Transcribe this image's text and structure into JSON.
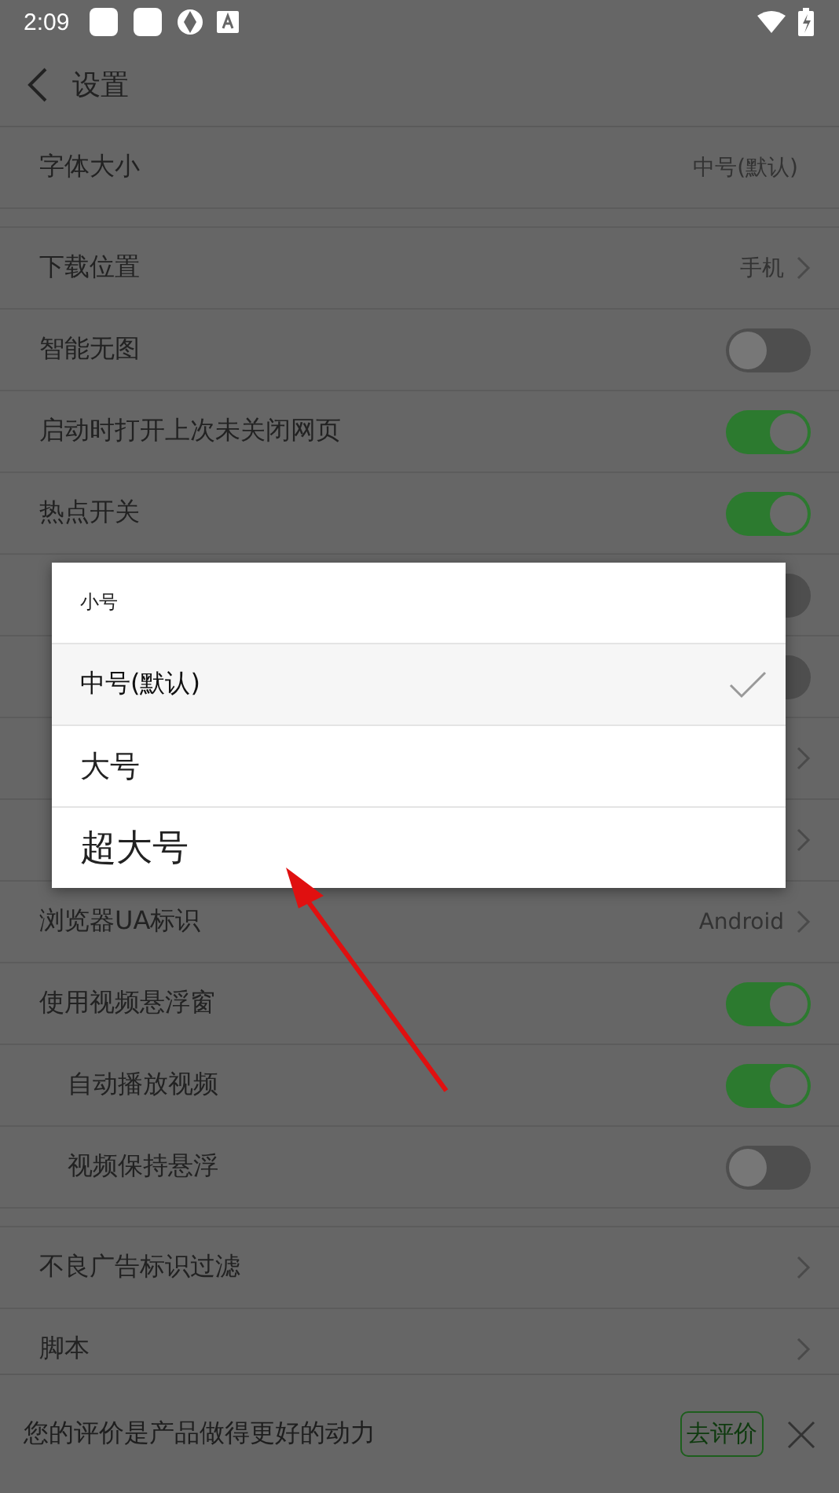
{
  "status_bar": {
    "time": "2:09"
  },
  "header": {
    "title": "设置"
  },
  "sections": [
    [
      {
        "kind": "value",
        "label": "字体大小",
        "value": "中号(默认)"
      }
    ],
    [
      {
        "kind": "link",
        "label": "下载位置",
        "value": "手机"
      },
      {
        "kind": "toggle",
        "label": "智能无图",
        "on": false
      },
      {
        "kind": "toggle",
        "label": "启动时打开上次未关闭网页",
        "on": true
      },
      {
        "kind": "toggle",
        "label": "热点开关",
        "on": true
      },
      {
        "kind": "toggle",
        "on": false
      },
      {
        "kind": "toggle",
        "on": false
      },
      {
        "kind": "link"
      },
      {
        "kind": "link"
      },
      {
        "kind": "link",
        "label": "浏览器UA标识",
        "value": "Android"
      },
      {
        "kind": "toggle",
        "label": "使用视频悬浮窗",
        "on": true,
        "children": [
          {
            "kind": "toggle",
            "label": "自动播放视频",
            "on": true
          },
          {
            "kind": "toggle",
            "label": "视频保持悬浮",
            "on": false
          }
        ]
      }
    ],
    [
      {
        "kind": "link",
        "label": "不良广告标识过滤"
      },
      {
        "kind": "link",
        "label": "脚本"
      }
    ]
  ],
  "dialog": {
    "options": [
      {
        "kind": "small",
        "label": "小号",
        "selected": false
      },
      {
        "kind": "medium",
        "label": "中号(默认)",
        "selected": true
      },
      {
        "kind": "large",
        "label": "大号",
        "selected": false
      },
      {
        "kind": "xlarge",
        "label": "超大号",
        "selected": false
      }
    ]
  },
  "rating_bar": {
    "text": "您的评价是产品做得更好的动力",
    "button": "去评价"
  }
}
